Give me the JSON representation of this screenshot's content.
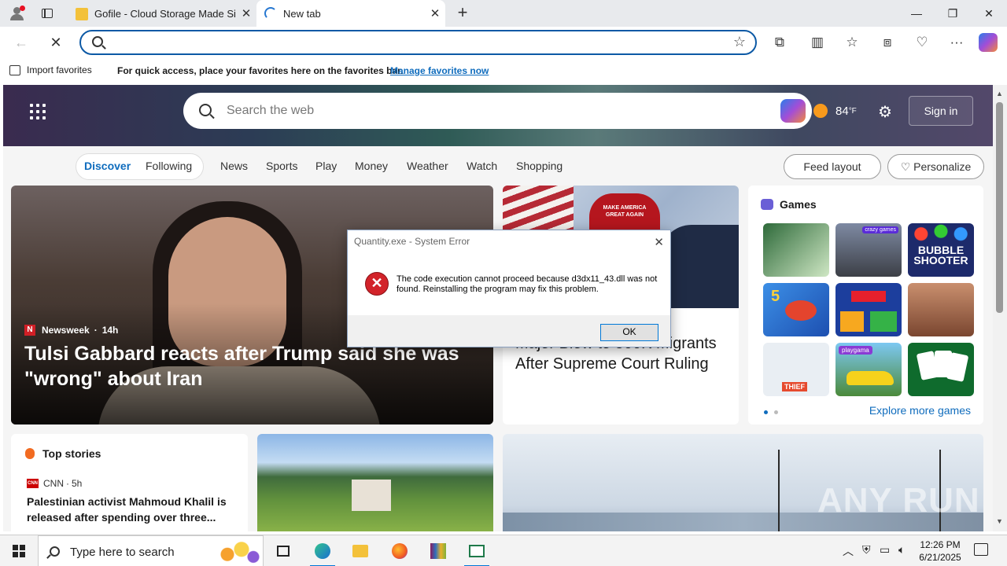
{
  "browser": {
    "tabs": [
      {
        "title": "Gofile - Cloud Storage Made Simp",
        "active": false
      },
      {
        "title": "New tab",
        "active": true
      }
    ],
    "window_controls": {
      "minimize": "—",
      "restore": "❐",
      "close": "✕"
    },
    "address_bar": {
      "value": "",
      "placeholder": ""
    },
    "favorites_bar": {
      "import_label": "Import favorites",
      "message": "For quick access, place your favorites here on the favorites bar.",
      "link": "Manage favorites now"
    }
  },
  "ntp": {
    "search_placeholder": "Search the web",
    "weather": {
      "temp": "84",
      "unit": "°F"
    },
    "signin_label": "Sign in",
    "nav": {
      "items": [
        "Discover",
        "Following",
        "News",
        "Sports",
        "Play",
        "Money",
        "Weather",
        "Watch",
        "Shopping"
      ],
      "active": "Discover",
      "feed_layout": "Feed layout",
      "personalize": "Personalize"
    },
    "lead_story": {
      "source": "Newsweek",
      "age": "14h",
      "headline": "Tulsi Gabbard reacts after Trump said she was \"wrong\" about Iran"
    },
    "second_story": {
      "image_text": "MAKE AMERICA GREAT AGAIN",
      "headline": "Major Blow to 500K Migrants After Supreme Court Ruling"
    },
    "games": {
      "title": "Games",
      "tile_texts": {
        "crazy": "crazy games",
        "bubble": "BUBBLE SHOOTER",
        "playgama": "playgama",
        "thief": "THIEF",
        "five": "5"
      },
      "explore": "Explore more games"
    },
    "top_stories": {
      "title": "Top stories",
      "source": "CNN",
      "age": "5h",
      "headline": "Palestinian activist Mahmoud Khalil is released after spending over three..."
    },
    "watermark": "ANY RUN"
  },
  "dialog": {
    "title": "Quantity.exe - System Error",
    "message": "The code execution cannot proceed because d3dx11_43.dll was not found. Reinstalling the program may fix this problem.",
    "ok_label": "OK"
  },
  "taskbar": {
    "search_placeholder": "Type here to search",
    "time": "12:26 PM",
    "date": "6/21/2025"
  },
  "colors": {
    "accent": "#0f6cbd",
    "error_red": "#d2232a",
    "edge_blue": "#0c59a5"
  }
}
